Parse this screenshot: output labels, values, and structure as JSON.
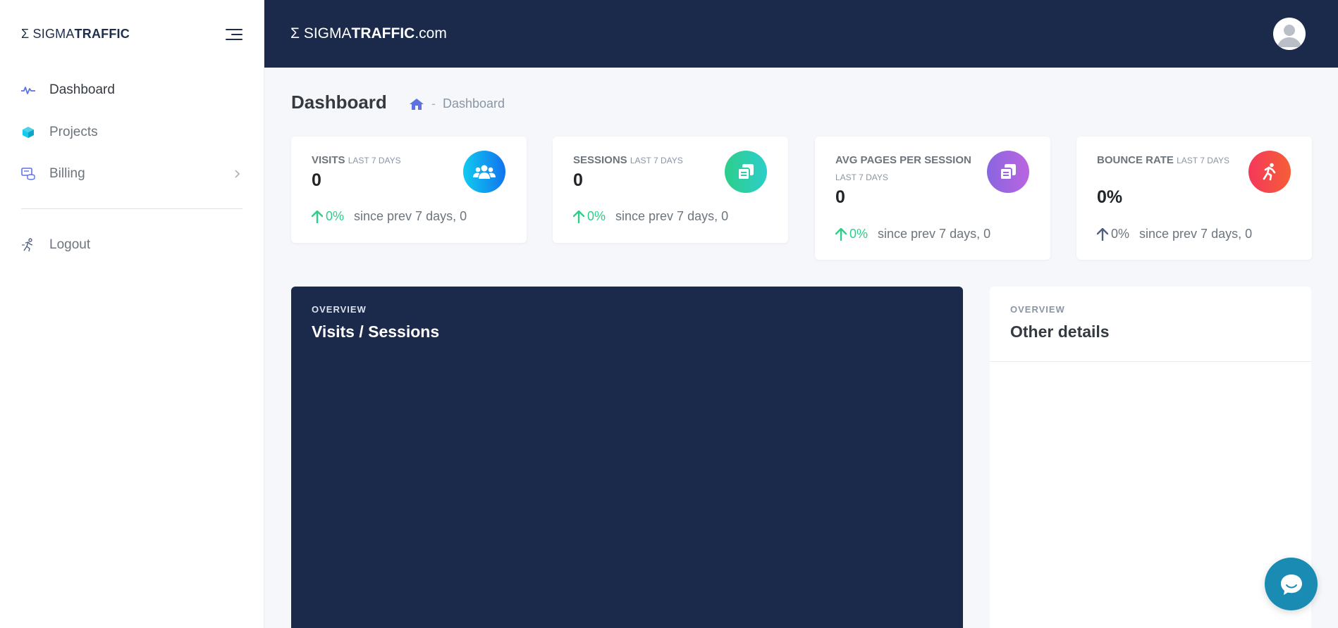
{
  "sidebar": {
    "brand": {
      "sigma": "Σ",
      "light": "SIGMA",
      "bold": "TRAFFIC"
    },
    "items": [
      {
        "label": "Dashboard",
        "icon": "pulse-icon"
      },
      {
        "label": "Projects",
        "icon": "cube-icon"
      },
      {
        "label": "Billing",
        "icon": "billing-icon"
      },
      {
        "label": "Logout",
        "icon": "runner-icon"
      }
    ]
  },
  "topbar": {
    "brand": {
      "sigma": "Σ",
      "light": "SIGMA",
      "bold": "TRAFFIC",
      "suffix": ".com"
    }
  },
  "header": {
    "title": "Dashboard",
    "breadcrumb": {
      "separator": "-",
      "current": "Dashboard"
    }
  },
  "stats": [
    {
      "title": "VISITS",
      "period": "LAST 7 DAYS",
      "value": "0",
      "change": "0%",
      "since": "since prev 7 days, 0",
      "trend_color": "#2dce89",
      "icon": "users-icon",
      "icon_colors": [
        "#11cdef",
        "#1171ef"
      ]
    },
    {
      "title": "SESSIONS",
      "period": "LAST 7 DAYS",
      "value": "0",
      "change": "0%",
      "since": "since prev 7 days, 0",
      "trend_color": "#2dce89",
      "icon": "copy-icon",
      "icon_colors": [
        "#2dce89",
        "#2dcecc"
      ]
    },
    {
      "title": "AVG PAGES PER SESSION",
      "period": "LAST 7 DAYS",
      "value": "0",
      "change": "0%",
      "since": "since prev 7 days, 0",
      "trend_color": "#2dce89",
      "icon": "copy-icon",
      "icon_colors": [
        "#8965e0",
        "#bc65e0"
      ]
    },
    {
      "title": "BOUNCE RATE",
      "period": "LAST 7 DAYS",
      "value": "0%",
      "change": "0%",
      "since": "since prev 7 days, 0",
      "trend_color": "#525f7f",
      "icon": "running-icon",
      "icon_colors": [
        "#f5365c",
        "#f56036"
      ]
    }
  ],
  "panels": {
    "visits": {
      "eyebrow": "OVERVIEW",
      "title": "Visits / Sessions"
    },
    "other": {
      "eyebrow": "OVERVIEW",
      "title": "Other details"
    }
  },
  "colors": {
    "navy": "#1b2a4a",
    "page_bg": "#f5f7fb",
    "chat": "#1a8bb3"
  }
}
